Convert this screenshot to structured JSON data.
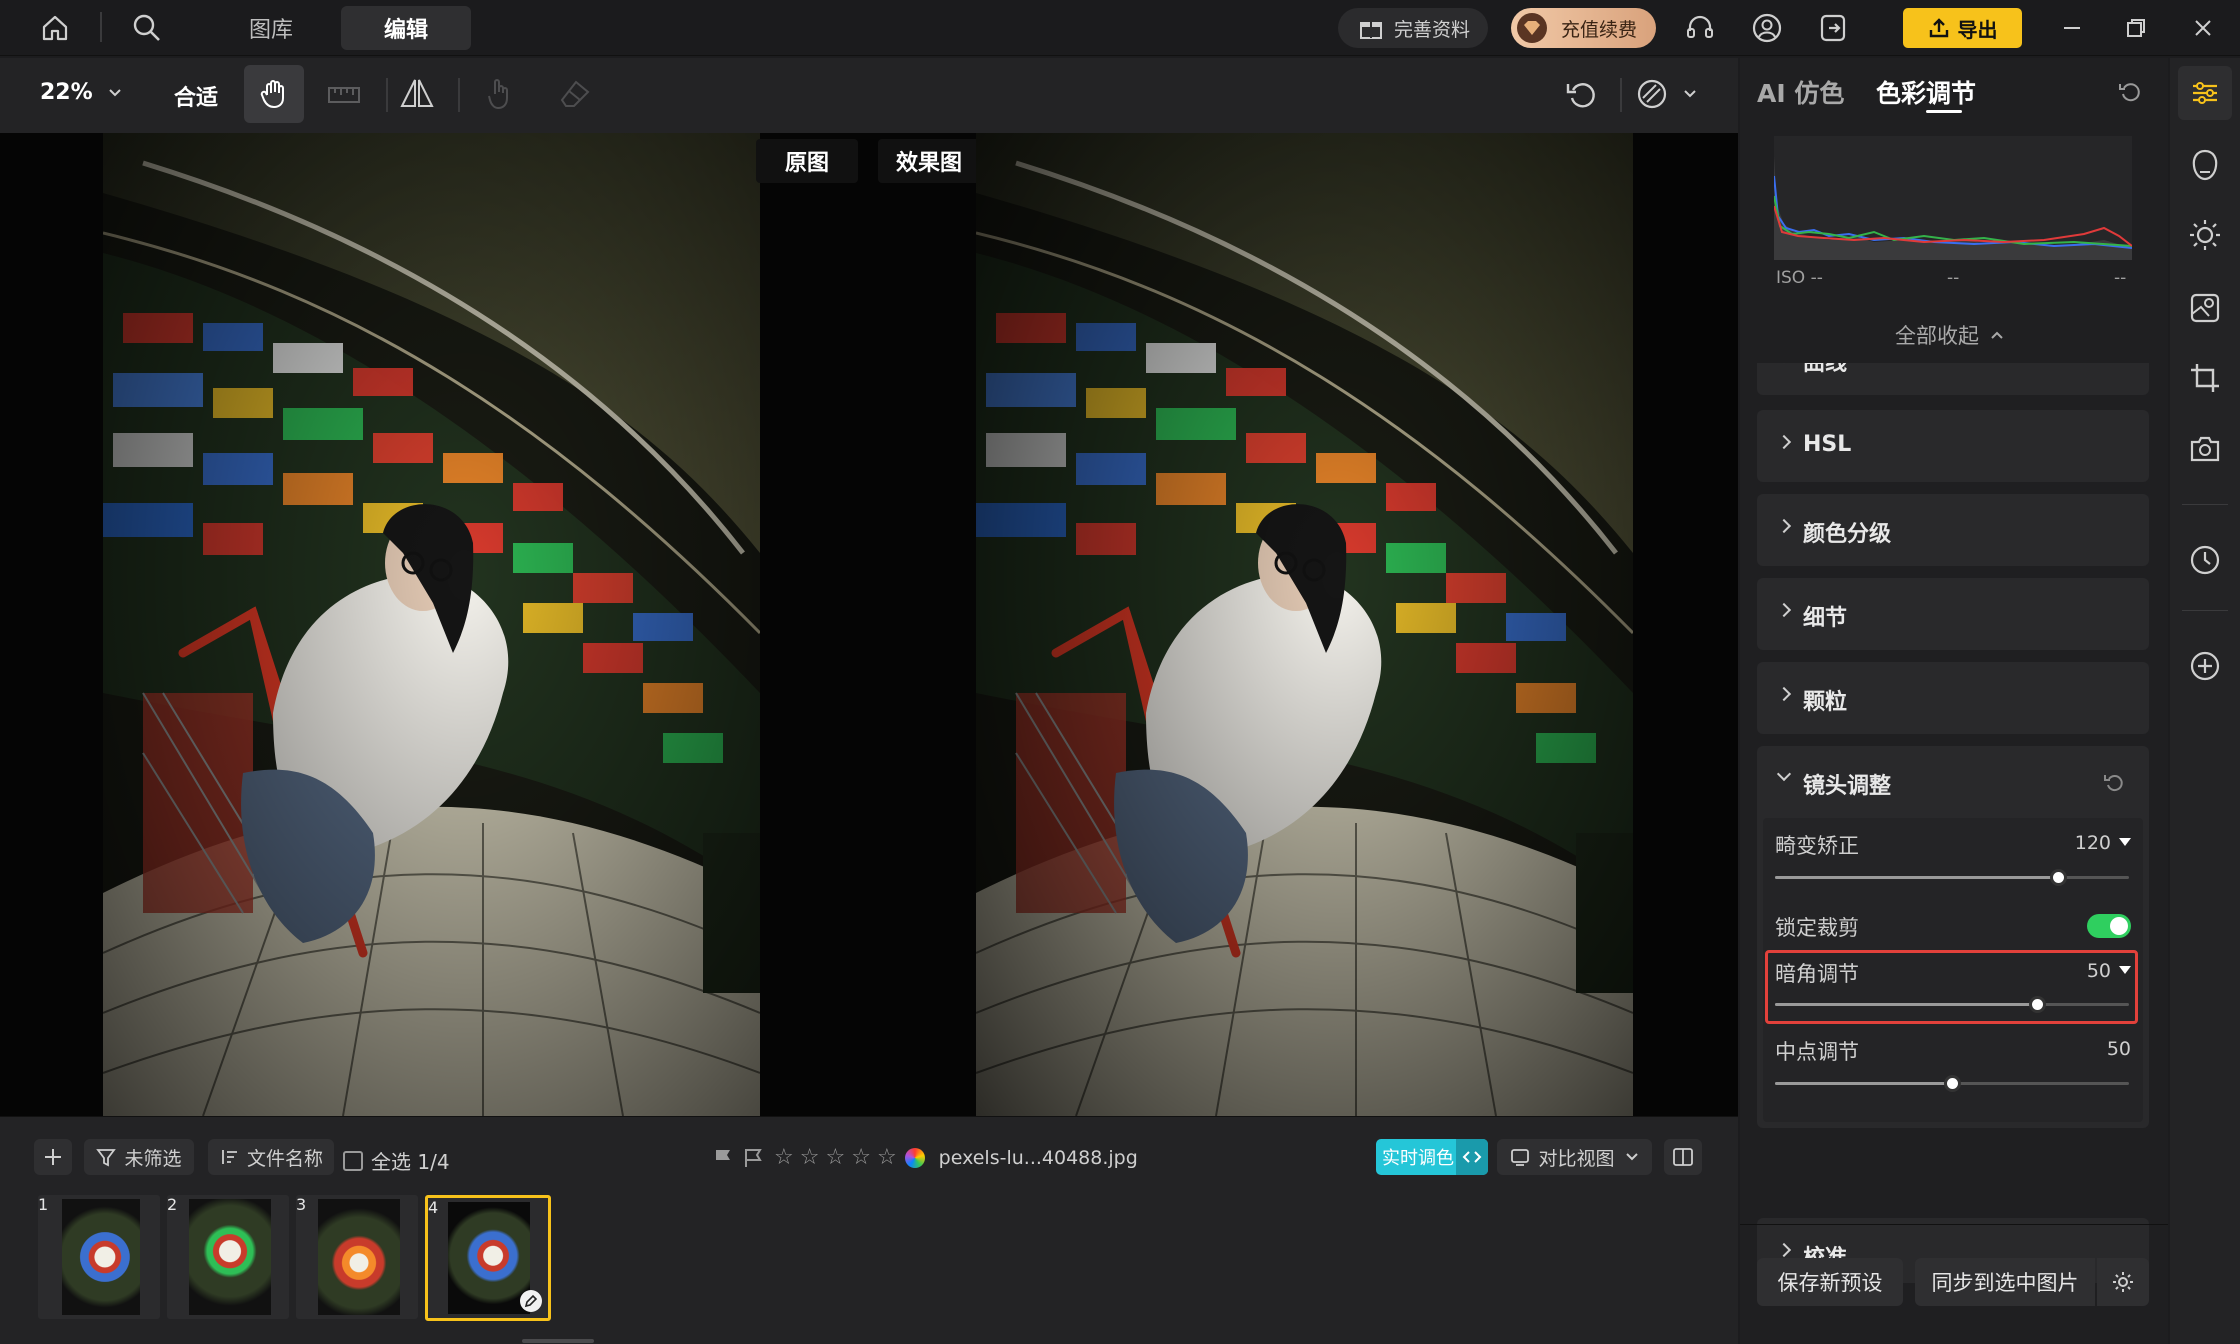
{
  "top_nav": {
    "tab_library": "图库",
    "tab_edit": "编辑",
    "complete_info": "完善资料",
    "recharge": "充值续费",
    "export": "导出"
  },
  "toolbar": {
    "zoom": "22%",
    "fit": "合适"
  },
  "canvas": {
    "original_label": "原图",
    "effect_label": "效果图"
  },
  "filmstrip": {
    "filter_label": "未筛选",
    "sort_label": "文件名称",
    "select_all": "全选 1/4",
    "filename": "pexels-lu...40488.jpg",
    "live_color": "实时调色",
    "compare_view": "对比视图",
    "thumbs": [
      {
        "num": "1"
      },
      {
        "num": "2"
      },
      {
        "num": "3"
      },
      {
        "num": "4"
      }
    ],
    "rating_stars": 0
  },
  "panel": {
    "tab_ai": "AI 仿色",
    "tab_color": "色彩调节",
    "iso_label": "ISO --",
    "hist_mid": "--",
    "hist_right": "--",
    "collapse_all": "全部收起",
    "sections": {
      "curves": "曲线",
      "hsl": "HSL",
      "grading": "颜色分级",
      "detail": "细节",
      "grain": "颗粒",
      "lens": "镜头调整",
      "calibration": "校准"
    },
    "lens": {
      "distortion_label": "畸变矫正",
      "distortion_value": "120",
      "distortion_fraction": 0.8,
      "lock_crop_label": "锁定裁剪",
      "lock_crop_on": true,
      "vignette_label": "暗角调节",
      "vignette_value": "50",
      "vignette_fraction": 0.74,
      "midpoint_label": "中点调节",
      "midpoint_value": "50",
      "midpoint_fraction": 0.5
    },
    "save_preset": "保存新预设",
    "sync_selected": "同步到选中图片"
  },
  "colors": {
    "accent_yellow": "#f7c21b",
    "accent_cyan": "#25c6d8",
    "toggle_green": "#2fcf5f",
    "highlight_red": "#e2413b"
  }
}
